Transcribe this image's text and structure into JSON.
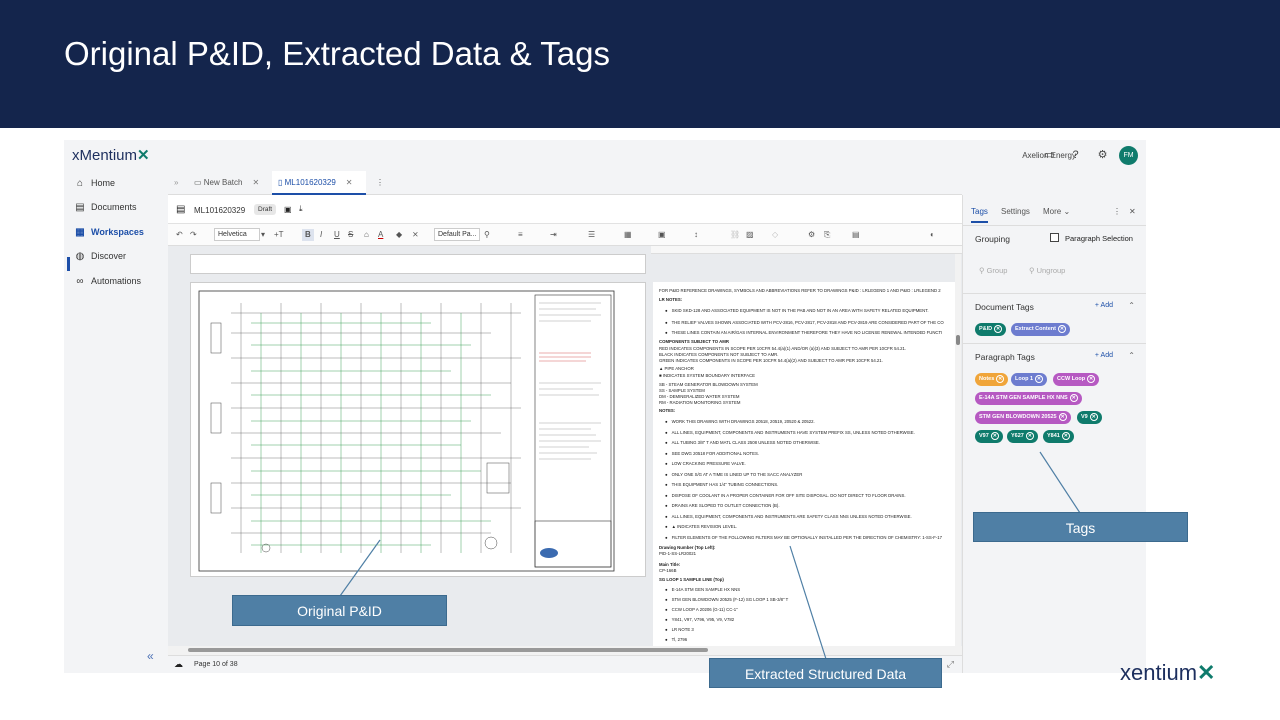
{
  "slide": {
    "title": "Original P&ID, Extracted Data & Tags",
    "footer_logo": {
      "prefix": "x",
      "text": "entium",
      "mark": "✕"
    }
  },
  "app": {
    "logo": {
      "text": "xMentium",
      "mark": "✕"
    },
    "account": "Axelion Energy",
    "avatar": "FM",
    "nav": [
      {
        "label": "Home",
        "icon": "home-icon"
      },
      {
        "label": "Documents",
        "icon": "document-icon"
      },
      {
        "label": "Workspaces",
        "icon": "workspaces-icon",
        "active": true
      },
      {
        "label": "Discover",
        "icon": "globe-icon"
      },
      {
        "label": "Automations",
        "icon": "automations-icon"
      }
    ],
    "collapse": "«",
    "tabs": [
      {
        "label": "New Batch"
      },
      {
        "label": "ML101620329",
        "active": true
      }
    ],
    "document": {
      "name": "ML101620329",
      "status": "Draft"
    },
    "toolbar": {
      "font": "Helvetica",
      "style": "Default Pa..."
    },
    "page_indicator": "Page 10 of 38",
    "text_lines": [
      {
        "t": "FOR P&ID REFERENCE DRAWINGS, SYMBOLS AND ABBREVIATIONS REFER TO DRAWINGS P&ID : LRLEGEND 1 AND P&ID : LRLEGEND 2",
        "k": "p"
      },
      {
        "t": "LR NOTES:",
        "k": "b"
      },
      {
        "t": "SKID SKD-128 AND ASSOCIATED EQUIPMENT IS NOT IN THE PAB AND NOT IN AN AREA WITH SAFETY RELATED EQUIPMENT.",
        "k": "u"
      },
      {
        "t": "THE RELIEF VALVES SHOWN ASSOCIATED WITH PCV-2816, PCV-2817, PCV-2818 AND PCV-2819 ARE CONSIDERED PART OF THE CO",
        "k": "u"
      },
      {
        "t": "THESE LINES CONTAIN AN AIR/GAS INTERNAL ENVIRONMENT THEREFORE THEY HAVE NO LICENSE RENEWAL INTENDED FUNCTI",
        "k": "u"
      },
      {
        "t": "COMPONENTS SUBJECT TO AMR",
        "k": "b"
      },
      {
        "t": "RED INDICATES COMPONENTS IN SCOPE PER 10CFR 54.4(a)(1) AND/OR (a)(3) AND SUBJECT TO AMR PER 10CFR 54.21.",
        "k": "p"
      },
      {
        "t": "BLACK INDICATES COMPONENTS NOT SUBJECT TO AMR.",
        "k": "p"
      },
      {
        "t": "GREEN INDICATES COMPONENTS IN SCOPE PER 10CFR 54.4(a)(2) AND SUBJECT TO AMR PER 10CFR 54.21.",
        "k": "p"
      },
      {
        "t": "▲ PIPE ANCHOR",
        "k": "p"
      },
      {
        "t": "■ INDICATES SYSTEM BOUNDARY INTERFACE",
        "k": "p"
      },
      {
        "t": "SB - STEAM GENERATOR BLOWDOWN SYSTEM",
        "k": "p"
      },
      {
        "t": "SS - SAMPLE SYSTEM",
        "k": "p"
      },
      {
        "t": "DM - DEMINERALIZED WATER SYSTEM",
        "k": "p"
      },
      {
        "t": "RM - RADIATION MONITORING SYSTEM",
        "k": "p"
      },
      {
        "t": "NOTES:",
        "k": "b"
      },
      {
        "t": "WORK THIS DRAWING WITH DRAWINGS 20518, 20519, 20520 & 20522.",
        "k": "u"
      },
      {
        "t": "ALL LINES, EQUIPMENT, COMPONENTS AND INSTRUMENTS HAVE SYSTEM PREFIX SS, UNLESS NOTED OTHERWISE.",
        "k": "u"
      },
      {
        "t": "ALL TUBING 3/8\" T AND MATL CLASS 2508 UNLESS NOTED OTHERWISE.",
        "k": "u"
      },
      {
        "t": "SEE DWG 20518 FOR ADDITIONAL NOTES.",
        "k": "u"
      },
      {
        "t": "LOW CRACKING PRESSURE VALVE.",
        "k": "u"
      },
      {
        "t": "ONLY ONE S/G AT A TIME IS LINED UP TO THE SACC ANALYZER",
        "k": "u"
      },
      {
        "t": "THIS EQUIPMENT HAS 1/4\" TUBING CONNECTIONS.",
        "k": "u"
      },
      {
        "t": "DISPOSE OF COOLANT IN A PROPER CONTAINER FOR OFF SITE DISPOSAL. DO NOT DIRECT TO FLOOR DRAINS.",
        "k": "u"
      },
      {
        "t": "DRAINS ARE SLOPED TO OUTLET CONNECTION (B).",
        "k": "u"
      },
      {
        "t": "ALL LINES, EQUIPMENT, COMPONENTS AND INSTRUMENTS ARE SAFETY CLASS NNS UNLESS NOTED OTHERWISE.",
        "k": "u"
      },
      {
        "t": "▲ INDICATES REVISION LEVEL.",
        "k": "u"
      },
      {
        "t": "FILTER ELEMENTS OF THE FOLLOWING FILTERS MAY BE OPTIONALLY INSTALLED PER THE DIRECTION OF CHEMISTRY: 1-SS-F-17",
        "k": "u"
      },
      {
        "t": "Drawing Number (Top Left):",
        "k": "b"
      },
      {
        "t": "PID-1-SS-LR20021",
        "k": "p"
      },
      {
        "t": "Main Title:",
        "k": "b"
      },
      {
        "t": "CP-166B",
        "k": "p"
      },
      {
        "t": "SG LOOP 1 SAMPLE LINE (Top)",
        "k": "b"
      },
      {
        "t": "E-14A STM GEN SAMPLE HX NNS",
        "k": "u"
      },
      {
        "t": "STM GEN BLOWDOWN 20525 (F-12) SG LOOP 1 SB-3/8\" T",
        "k": "u"
      },
      {
        "t": "CCW LOOP A 20206 (G-11) CC-1\"",
        "k": "u"
      },
      {
        "t": "Y841, V97, V796, V95, V9, V782",
        "k": "u"
      },
      {
        "t": "LR NOTE 3",
        "k": "u"
      },
      {
        "t": "Tl, 2796",
        "k": "u"
      }
    ],
    "panel": {
      "tabs": [
        "Tags",
        "Settings",
        "More"
      ],
      "grouping": "Grouping",
      "paragraph_selection": "Paragraph Selection",
      "group": "Group",
      "ungroup": "Ungroup",
      "document_tags_title": "Document Tags",
      "paragraph_tags_title": "Paragraph Tags",
      "add": "Add",
      "document_tags": [
        {
          "label": "P&ID",
          "color": "#0f7b6c"
        },
        {
          "label": "Extract Content",
          "color": "#6d7ccf"
        }
      ],
      "paragraph_tags": [
        {
          "label": "Notes",
          "color": "#f0a53a"
        },
        {
          "label": "Loop 1",
          "color": "#6d7ccf"
        },
        {
          "label": "CCW Loop",
          "color": "#b659c2"
        },
        {
          "label": "E-14A STM GEN SAMPLE HX NNS",
          "color": "#b659c2"
        },
        {
          "label": "STM GEN BLOWDOWN 20525",
          "color": "#b659c2"
        },
        {
          "label": "V9",
          "color": "#0f7b6c"
        },
        {
          "label": "V97",
          "color": "#0f7b6c"
        },
        {
          "label": "Y627",
          "color": "#0f7b6c"
        },
        {
          "label": "Y841",
          "color": "#0f7b6c"
        }
      ]
    }
  },
  "callouts": {
    "pid": "Original P&ID",
    "extracted": "Extracted Structured Data",
    "tags": "Tags"
  }
}
